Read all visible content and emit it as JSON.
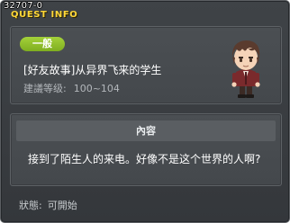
{
  "window": {
    "quest_id": "32707-0",
    "title": "QUEST INFO"
  },
  "quest": {
    "category": "一般",
    "title": "[好友故事]从异界飞来的学生",
    "level_label": "建議等级:",
    "level_range": "100~104"
  },
  "content": {
    "header": "內容",
    "text": "接到了陌生人的来电。好像不是这个世界的人啊?"
  },
  "status": {
    "label": "狀態:",
    "value": "可開始"
  },
  "icons": {
    "npc": "npc-student-portrait-icon"
  },
  "colors": {
    "title_accent": "#ffd839",
    "category_badge": "#8fbf2a",
    "window_bg": "#3a3d41"
  }
}
